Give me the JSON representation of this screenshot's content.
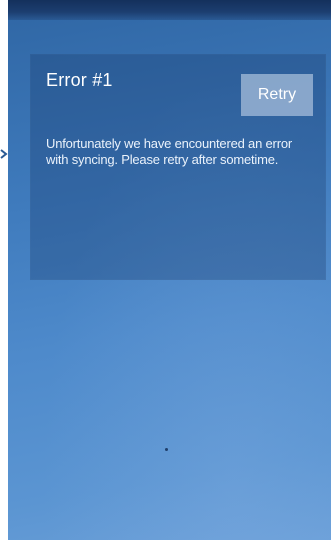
{
  "error": {
    "title": "Error #1",
    "retry_label": "Retry",
    "message": "Unfortunately we have encountered an error with syncing. Please retry after sometime."
  },
  "icons": {
    "left_edge": "chevron-right-icon"
  },
  "colors": {
    "background_top": "#2f66a4",
    "background_bottom": "#6a9fd8",
    "top_bar": "#14305c",
    "card": "#183c6e",
    "retry_button": "#aac0dc",
    "text": "#ffffff"
  }
}
